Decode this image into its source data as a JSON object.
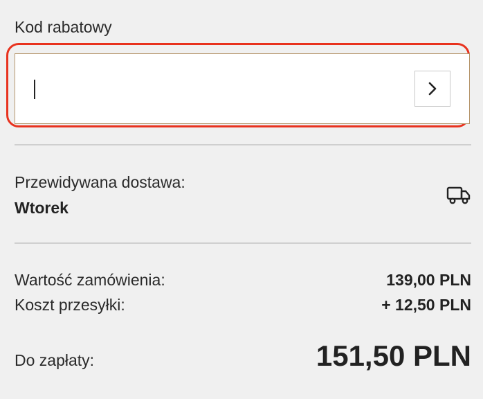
{
  "coupon": {
    "label": "Kod rabatowy",
    "value": "",
    "submit_icon": "chevron-right-icon"
  },
  "delivery": {
    "label": "Przewidywana dostawa:",
    "day": "Wtorek",
    "icon": "truck-icon"
  },
  "summary": {
    "order_value_label": "Wartość zamówienia:",
    "order_value": "139,00 PLN",
    "shipping_label": "Koszt przesyłki:",
    "shipping_value": "+ 12,50 PLN",
    "total_label": "Do zapłaty:",
    "total_value": "151,50 PLN"
  },
  "colors": {
    "highlight": "#e8321e",
    "field_border": "#b5956b",
    "background": "#f0f0f0"
  }
}
